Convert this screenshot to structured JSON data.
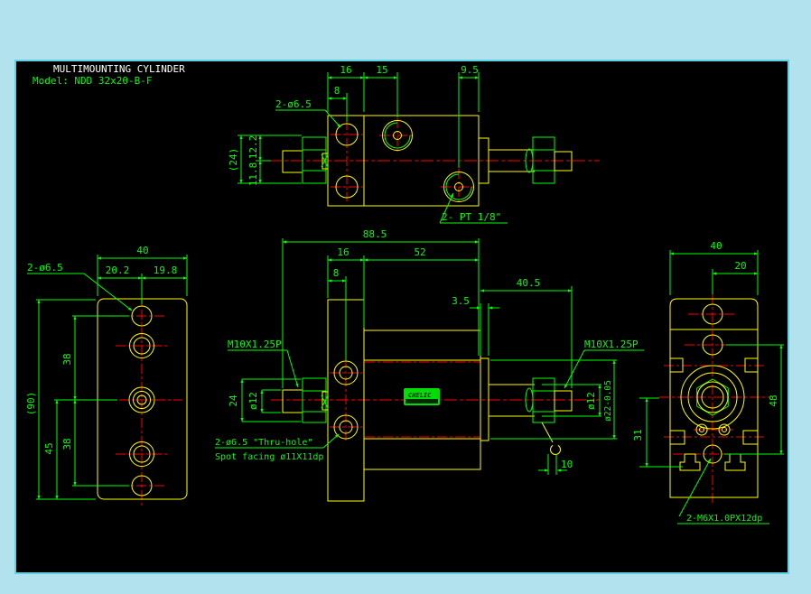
{
  "title": {
    "line1": "MULTIMOUNTING  CYLINDER",
    "line2": "Model:  NDD 32x20-B-F"
  },
  "brand": {
    "logo_text": "CHELIC"
  },
  "colors": {
    "object_line": "#ffff00",
    "dimension_line": "#00ff00",
    "centerline": "#ff0000",
    "title_text": "#ffffff",
    "canvas": "#000000",
    "frame": "#b2e2ee",
    "logo_green": "#00dd00"
  },
  "top_view": {
    "dim_16": "16",
    "dim_15": "15",
    "dim_9_5": "9.5",
    "dim_8": "8",
    "dim_24": "(24)",
    "dim_12_2": "12.2",
    "dim_11_8": "11.8",
    "label_holes": "2-ø6.5",
    "label_port": "2- PT 1/8\""
  },
  "front_view": {
    "dim_88_5": "88.5",
    "dim_16": "16",
    "dim_52": "52",
    "dim_8": "8",
    "dim_40_5": "40.5",
    "dim_3_5": "3.5",
    "dim_24": "24",
    "dim_rod_left": "ø12",
    "dim_rod_right": "ø12",
    "dim_boss": "ø22-0.05",
    "dim_10": "10",
    "label_thread_left": "M10X1.25P",
    "label_thread_right": "M10X1.25P",
    "label_thru_hole": "2-ø6.5 \"Thru-hole\"",
    "label_spot_facing": "Spot facing  ø11X11dp"
  },
  "left_view": {
    "dim_40": "40",
    "dim_20_2": "20.2",
    "dim_19_8": "19.8",
    "dim_90": "(90)",
    "dim_45": "45",
    "dim_38_top": "38",
    "dim_38_bottom": "38",
    "label_holes": "2-ø6.5"
  },
  "right_view": {
    "dim_40": "40",
    "dim_20": "20",
    "dim_48": "48",
    "dim_31": "31",
    "label_thread": "2-M6X1.0PX12dp"
  }
}
